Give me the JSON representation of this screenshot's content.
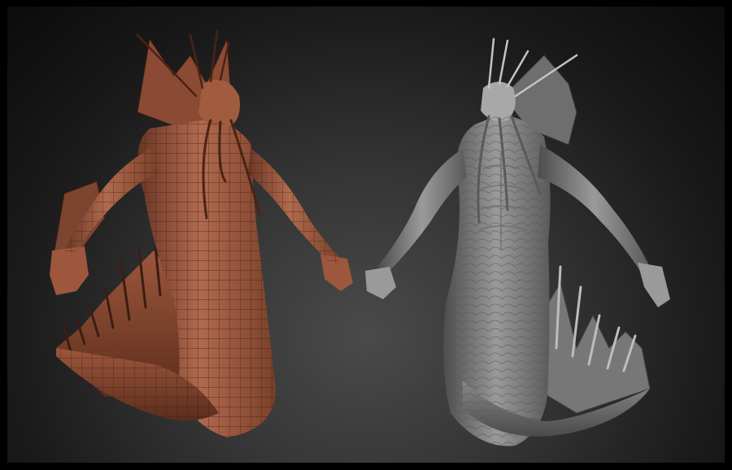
{
  "scene": {
    "figures": [
      {
        "name": "wireframe-model",
        "material": "terracotta-clay",
        "wireframe": true
      },
      {
        "name": "sculpted-model",
        "material": "grey-clay",
        "wireframe": false
      }
    ]
  },
  "colors": {
    "background_top": "#0b0b0b",
    "background_center": "#4a4a4a",
    "wire_model_base": "#b06a4e",
    "wire_model_shadow": "#6a3624",
    "wire_lines": "#3b1d12",
    "sculpt_base": "#8c8c8c",
    "sculpt_shadow": "#4c4c4c",
    "sculpt_highlight": "#b5b5b5"
  }
}
